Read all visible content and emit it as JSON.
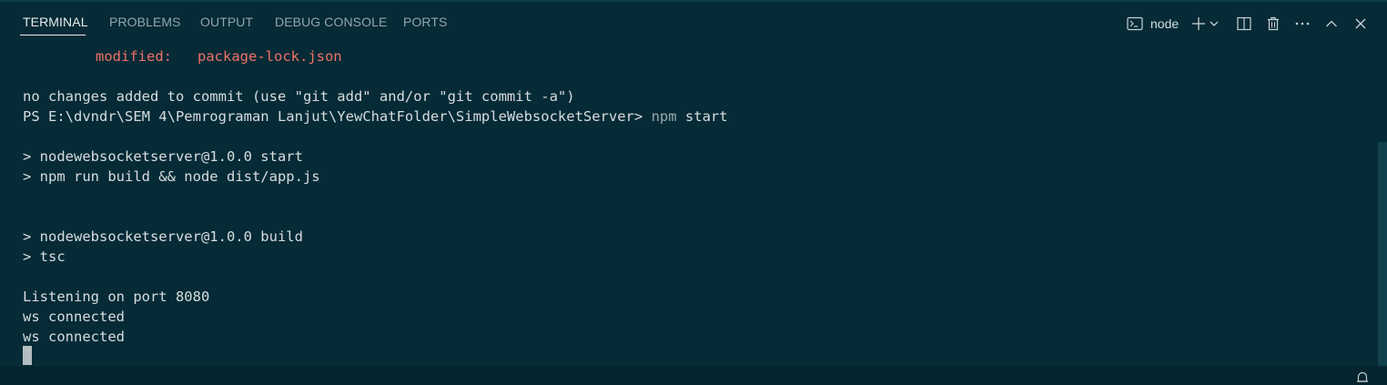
{
  "panel": {
    "tabs": [
      {
        "label": "TERMINAL",
        "active": true
      },
      {
        "label": "PROBLEMS",
        "active": false
      },
      {
        "label": "OUTPUT",
        "active": false
      },
      {
        "label": "DEBUG CONSOLE",
        "active": false
      },
      {
        "label": "PORTS",
        "active": false
      }
    ],
    "terminal_name": "node",
    "icons": [
      "terminal-icon",
      "plus-icon",
      "chevron-down-icon",
      "split-icon",
      "trash-icon",
      "more-icon",
      "chevron-up-icon",
      "close-icon"
    ]
  },
  "terminal": {
    "modified_label": "modified:",
    "modified_file": "package-lock.json",
    "lines": [
      "no changes added to commit (use \"git add\" and/or \"git commit -a\")",
      "> nodewebsocketserver@1.0.0 start",
      "> npm run build && node dist/app.js",
      "> nodewebsocketserver@1.0.0 build",
      "> tsc",
      "Listening on port 8080",
      "ws connected",
      "ws connected"
    ],
    "prompt": "PS E:\\dvndr\\SEM 4\\Pemrograman Lanjut\\YewChatFolder\\SimpleWebsocketServer>",
    "command_npm": "npm",
    "command_rest": " start"
  },
  "colors": {
    "background": "#062b36",
    "modified": "#f07167",
    "text": "#d6dde0"
  }
}
